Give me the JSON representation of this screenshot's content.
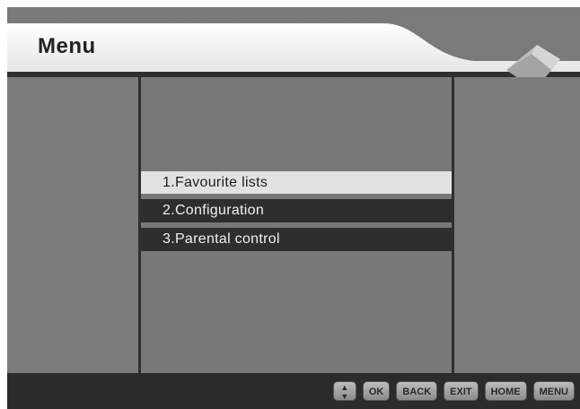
{
  "header": {
    "title": "Menu"
  },
  "menu": {
    "items": [
      {
        "label": "1.Favourite lists",
        "selected": true
      },
      {
        "label": "2.Configuration",
        "selected": false
      },
      {
        "label": "3.Parental control",
        "selected": false
      }
    ]
  },
  "footer": {
    "buttons": {
      "updown_icon": "up-down-arrows-icon",
      "ok": "OK",
      "back": "BACK",
      "exit": "EXIT",
      "home": "HOME",
      "menu": "MENU"
    }
  },
  "colors": {
    "background": "#7a7a7a",
    "header": "#ffffff",
    "selected": "#e2e2e2",
    "item": "#2e2e2e",
    "footer": "#2b2b2b"
  }
}
